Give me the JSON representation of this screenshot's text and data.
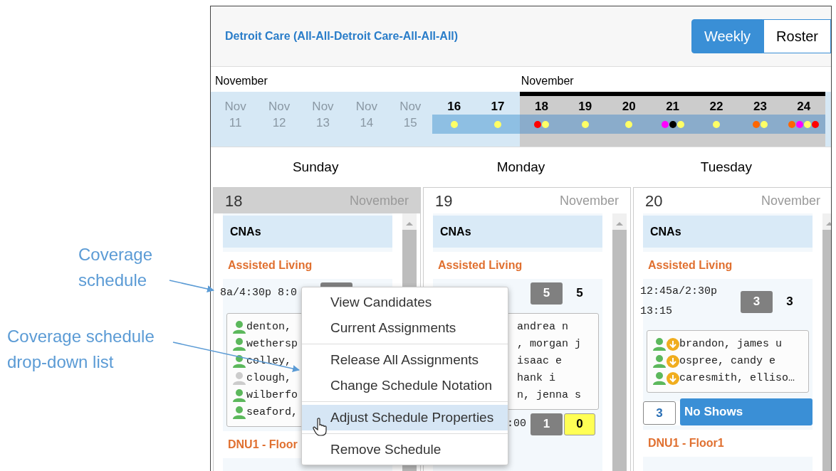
{
  "callouts": [
    {
      "text": "Coverage schedule"
    },
    {
      "text": "Coverage schedule drop-down list"
    }
  ],
  "header": {
    "title": "Detroit Care (All-All-Detroit Care-All-All-All)",
    "views": [
      {
        "label": "Weekly",
        "selected": true
      },
      {
        "label": "Roster",
        "selected": false
      }
    ]
  },
  "date_strip": [
    {
      "kind": "past",
      "month_label": "November",
      "month": "Nov",
      "day": "11",
      "selected": false
    },
    {
      "kind": "past",
      "month": "Nov",
      "day": "12",
      "selected": false
    },
    {
      "kind": "past",
      "month": "Nov",
      "day": "13",
      "selected": false
    },
    {
      "kind": "past",
      "month": "Nov",
      "day": "14",
      "selected": false
    },
    {
      "kind": "past",
      "month": "Nov",
      "day": "15",
      "selected": false
    },
    {
      "kind": "day",
      "day": "16",
      "selected": false,
      "dots": [
        {
          "color": "#ffff66"
        }
      ]
    },
    {
      "kind": "day",
      "day": "17",
      "selected": false,
      "dots": [
        {
          "color": "#ffff66"
        }
      ]
    },
    {
      "kind": "day",
      "month_label": "November",
      "day": "18",
      "selected": true,
      "dots": [
        {
          "color": "#ff0000"
        },
        {
          "color": "#ffff66"
        }
      ]
    },
    {
      "kind": "day",
      "day": "19",
      "selected": true,
      "dots": [
        {
          "color": "#ffff66"
        }
      ]
    },
    {
      "kind": "day",
      "day": "20",
      "selected": true,
      "dots": [
        {
          "color": "#ffff66"
        }
      ]
    },
    {
      "kind": "day",
      "day": "21",
      "selected": true,
      "dots": [
        {
          "color": "#ff00ff"
        },
        {
          "color": "#000000"
        },
        {
          "color": "#ffff66"
        }
      ]
    },
    {
      "kind": "day",
      "day": "22",
      "selected": true,
      "dots": [
        {
          "color": "#ffff66"
        }
      ]
    },
    {
      "kind": "day",
      "day": "23",
      "selected": true,
      "dots": [
        {
          "color": "#ff6600"
        },
        {
          "color": "#ffff66"
        }
      ]
    },
    {
      "kind": "day",
      "day": "24",
      "selected": true,
      "dots": [
        {
          "color": "#ff6600"
        },
        {
          "color": "#ff00ff"
        },
        {
          "color": "#ffff66"
        },
        {
          "color": "#ff0000"
        }
      ]
    }
  ],
  "columns": [
    {
      "weekday": "Sunday",
      "date": "18",
      "month": "November",
      "today": true,
      "group": "CNAs",
      "blocks": [
        {
          "kind": "unit",
          "label": "Assisted Living"
        },
        {
          "kind": "coverage",
          "time": "8a/4:30p 8:0",
          "count_highlight": false
        },
        {
          "kind": "names",
          "items": [
            {
              "text": "denton,",
              "active": true,
              "flag": false
            },
            {
              "text": "wethersp",
              "active": true,
              "flag": false
            },
            {
              "text": "colley,",
              "active": true,
              "flag": false
            },
            {
              "text": "clough,",
              "active": false,
              "flag": false
            },
            {
              "text": "wilberfo",
              "active": true,
              "flag": false
            },
            {
              "text": "seaford,",
              "active": true,
              "flag": false
            }
          ]
        },
        {
          "kind": "unit",
          "label": "DNU1 - Floor"
        }
      ]
    },
    {
      "weekday": "Monday",
      "date": "19",
      "month": "November",
      "today": false,
      "group": "CNAs",
      "blocks": [
        {
          "kind": "unit",
          "label": "Assisted Living"
        },
        {
          "kind": "coverage",
          "badge": "5",
          "count": "5",
          "count_highlight": false
        },
        {
          "kind": "names",
          "items": [
            {
              "text": "andrea n"
            },
            {
              "text": ", morgan j"
            },
            {
              "text": "isaac e"
            },
            {
              "text": "hank i"
            },
            {
              "text": "n, jenna s"
            }
          ]
        },
        {
          "kind": "coverage",
          "time": ":00",
          "badge": "1",
          "count": "0",
          "count_highlight": true
        }
      ]
    },
    {
      "weekday": "Tuesday",
      "date": "20",
      "month": "November",
      "today": false,
      "group": "CNAs",
      "blocks": [
        {
          "kind": "unit",
          "label": "Assisted Living"
        },
        {
          "kind": "coverage",
          "time": "12:45a/2:30p 13:15",
          "badge": "3",
          "count": "3",
          "count_highlight": false
        },
        {
          "kind": "names",
          "items": [
            {
              "text": "brandon, james u",
              "active": true,
              "flag": true
            },
            {
              "text": "ospree, candy e",
              "active": true,
              "flag": true
            },
            {
              "text": "caresmith, elliso…",
              "active": true,
              "flag": true
            }
          ]
        },
        {
          "kind": "no_shows",
          "count": "3",
          "label": "No Shows"
        },
        {
          "kind": "unit",
          "label": "DNU1 - Floor1"
        }
      ]
    }
  ],
  "context_menu": {
    "groups": [
      [
        {
          "label": "View Candidates",
          "selected": false
        },
        {
          "label": "Current Assignments",
          "selected": false
        }
      ],
      [
        {
          "label": "Release All Assignments",
          "selected": false
        },
        {
          "label": "Change Schedule Notation",
          "selected": false
        }
      ],
      [
        {
          "label": "Adjust Schedule Properties",
          "selected": true
        }
      ],
      [
        {
          "label": "Remove Schedule",
          "selected": false
        }
      ]
    ]
  }
}
